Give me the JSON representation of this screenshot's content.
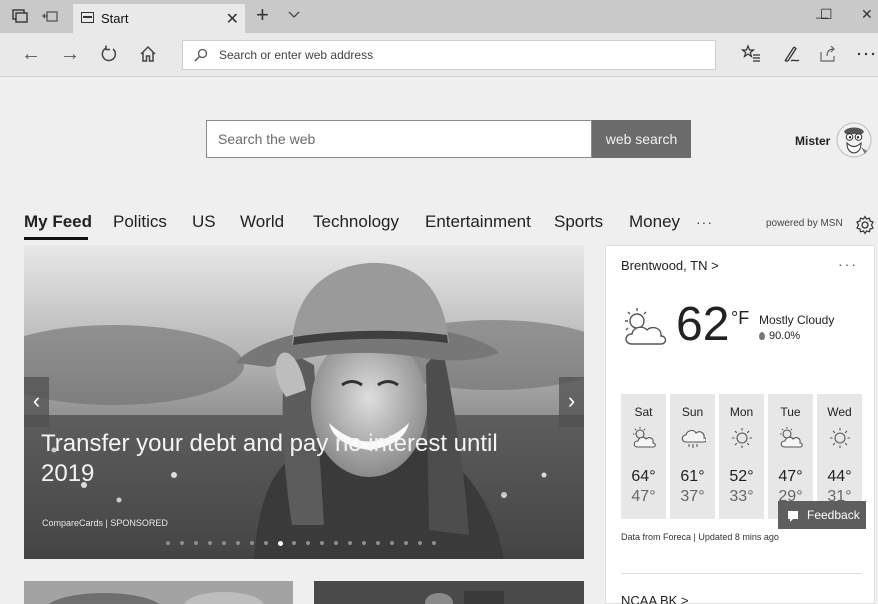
{
  "browser": {
    "tab": {
      "title": "Start",
      "close_glyph": "✕"
    },
    "new_tab_glyph": "+",
    "window": {
      "minimize": "—",
      "maximize": "☐",
      "close": "✕"
    },
    "address": {
      "placeholder": "Search or enter web address",
      "value": ""
    },
    "nav": {
      "back": "←",
      "forward": "→"
    }
  },
  "page": {
    "search": {
      "placeholder": "Search the web",
      "button_label": "web search"
    },
    "user": {
      "name": "Mister"
    },
    "feed_tabs": [
      "My Feed",
      "Politics",
      "US",
      "World",
      "Technology",
      "Entertainment",
      "Sports",
      "Money"
    ],
    "active_tab": "My Feed",
    "more_label": "···",
    "powered_by": "powered by MSN",
    "hero": {
      "title": "Transfer your debt and pay no interest until 2019",
      "source": "CompareCards | SPONSORED",
      "prev": "‹",
      "next": "›",
      "slide_count": 20,
      "active_slide": 9
    },
    "weather": {
      "location": "Brentwood, TN >",
      "menu": "···",
      "temperature": "62",
      "unit": "°F",
      "condition": "Mostly Cloudy",
      "precip": "90.0%",
      "forecast": [
        {
          "day": "Sat",
          "icon": "partly-cloudy-icon",
          "hi": "64°",
          "lo": "47°"
        },
        {
          "day": "Sun",
          "icon": "rain-icon",
          "hi": "61°",
          "lo": "37°"
        },
        {
          "day": "Mon",
          "icon": "sunny-icon",
          "hi": "52°",
          "lo": "33°"
        },
        {
          "day": "Tue",
          "icon": "partly-cloudy-icon",
          "hi": "47°",
          "lo": "29°"
        },
        {
          "day": "Wed",
          "icon": "sunny-icon",
          "hi": "44°",
          "lo": "31°"
        }
      ],
      "source": "Data from Foreca | Updated 8 mins ago",
      "next_section": "NCAA BK >"
    },
    "feedback_label": "Feedback"
  },
  "colors": {
    "titlebar": "#c9c9c9",
    "toolbar": "#e9e9e9",
    "page_bg": "#efefef",
    "search_button": "#6b6b6b",
    "feedback_button": "#5e5e5e"
  }
}
